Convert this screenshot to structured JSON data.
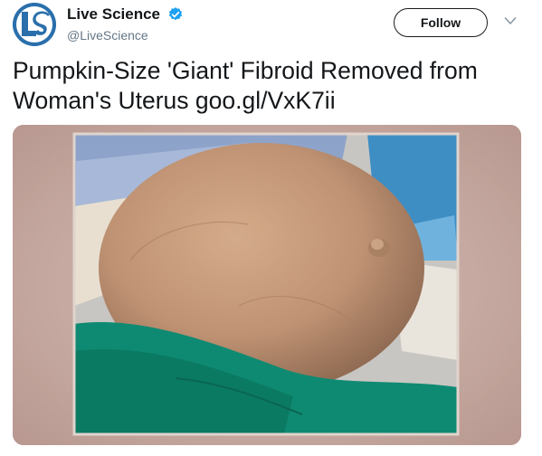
{
  "author": {
    "name": "Live Science",
    "handle": "@LiveScience",
    "avatar_letters": "LS",
    "verified_icon": "verified-badge-icon",
    "verified_color": "#1da1f2"
  },
  "actions": {
    "follow_label": "Follow",
    "menu_icon": "chevron-down-icon"
  },
  "tweet": {
    "text": "Pumpkin-Size 'Giant' Fibroid Removed from Woman's Uterus goo.gl/VxK7ii"
  },
  "media": {
    "icon": "photo"
  },
  "colors": {
    "text": "#14171a",
    "secondary_text": "#657786",
    "avatar_bg": "#2a6fab"
  }
}
